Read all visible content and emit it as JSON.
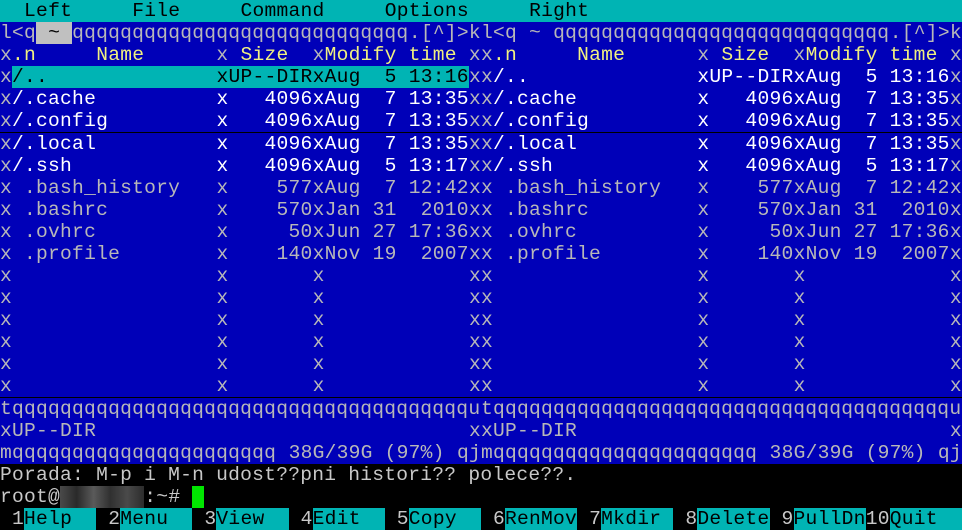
{
  "colors": {
    "panel_bg": "#0000b8",
    "menu_bg": "#00b4b4",
    "menu_fg": "#000000",
    "frame_fg": "#b8b8b8",
    "header_fg": "#f0f080",
    "dir_fg": "#ffffff",
    "file_fg": "#b8b8b8",
    "selected_bg": "#00b4b4",
    "terminal_bg": "#000000",
    "terminal_fg": "#c8c8c8",
    "path_tag_bg": "#c0c0c0",
    "cursor": "#00e600"
  },
  "menu_bar": {
    "items": [
      "Left",
      "File",
      "Command",
      "Options",
      "Right"
    ]
  },
  "left_panel": {
    "path": "~",
    "columns": [
      ".n",
      "Name",
      "Size",
      "Modify time"
    ],
    "files": [
      {
        "name": "/..",
        "size": "UP--DIR",
        "mtime": "Aug  5 13:16",
        "type": "dir",
        "selected": true
      },
      {
        "name": "/.cache",
        "size": "4096",
        "mtime": "Aug  7 13:35",
        "type": "dir"
      },
      {
        "name": "/.config",
        "size": "4096",
        "mtime": "Aug  7 13:35",
        "type": "dir"
      },
      {
        "name": "/.local",
        "size": "4096",
        "mtime": "Aug  7 13:35",
        "type": "dir"
      },
      {
        "name": "/.ssh",
        "size": "4096",
        "mtime": "Aug  5 13:17",
        "type": "dir"
      },
      {
        "name": " .bash_history",
        "size": "577",
        "mtime": "Aug  7 12:42",
        "type": "file"
      },
      {
        "name": " .bashrc",
        "size": "570",
        "mtime": "Jan 31  2010",
        "type": "file"
      },
      {
        "name": " .ovhrc",
        "size": "50",
        "mtime": "Jun 27 17:36",
        "type": "file"
      },
      {
        "name": " .profile",
        "size": "140",
        "mtime": "Nov 19  2007",
        "type": "file"
      }
    ],
    "status": "UP--DIR",
    "disk_usage": " 38G/39G (97%) "
  },
  "right_panel": {
    "path": "~",
    "columns": [
      ".n",
      "Name",
      "Size",
      "Modify time"
    ],
    "files": [
      {
        "name": "/..",
        "size": "UP--DIR",
        "mtime": "Aug  5 13:16",
        "type": "dir"
      },
      {
        "name": "/.cache",
        "size": "4096",
        "mtime": "Aug  7 13:35",
        "type": "dir"
      },
      {
        "name": "/.config",
        "size": "4096",
        "mtime": "Aug  7 13:35",
        "type": "dir"
      },
      {
        "name": "/.local",
        "size": "4096",
        "mtime": "Aug  7 13:35",
        "type": "dir"
      },
      {
        "name": "/.ssh",
        "size": "4096",
        "mtime": "Aug  5 13:17",
        "type": "dir"
      },
      {
        "name": " .bash_history",
        "size": "577",
        "mtime": "Aug  7 12:42",
        "type": "file"
      },
      {
        "name": " .bashrc",
        "size": "570",
        "mtime": "Jan 31  2010",
        "type": "file"
      },
      {
        "name": " .ovhrc",
        "size": "50",
        "mtime": "Jun 27 17:36",
        "type": "file"
      },
      {
        "name": " .profile",
        "size": "140",
        "mtime": "Nov 19  2007",
        "type": "file"
      }
    ],
    "status": "UP--DIR",
    "disk_usage": " 38G/39G (97%) "
  },
  "hint": "Porada: M-p i M-n udost??pni histori?? polece??.",
  "prompt": {
    "user": "root@",
    "host_redacted": "       ",
    "suffix": ":~#"
  },
  "function_keys": [
    {
      "num": "1",
      "label": "Help"
    },
    {
      "num": "2",
      "label": "Menu"
    },
    {
      "num": "3",
      "label": "View"
    },
    {
      "num": "4",
      "label": "Edit"
    },
    {
      "num": "5",
      "label": "Copy"
    },
    {
      "num": "6",
      "label": "RenMov"
    },
    {
      "num": "7",
      "label": "Mkdir"
    },
    {
      "num": "8",
      "label": "Delete"
    },
    {
      "num": "9",
      "label": "PullDn"
    },
    {
      "num": "10",
      "label": "Quit"
    }
  ]
}
